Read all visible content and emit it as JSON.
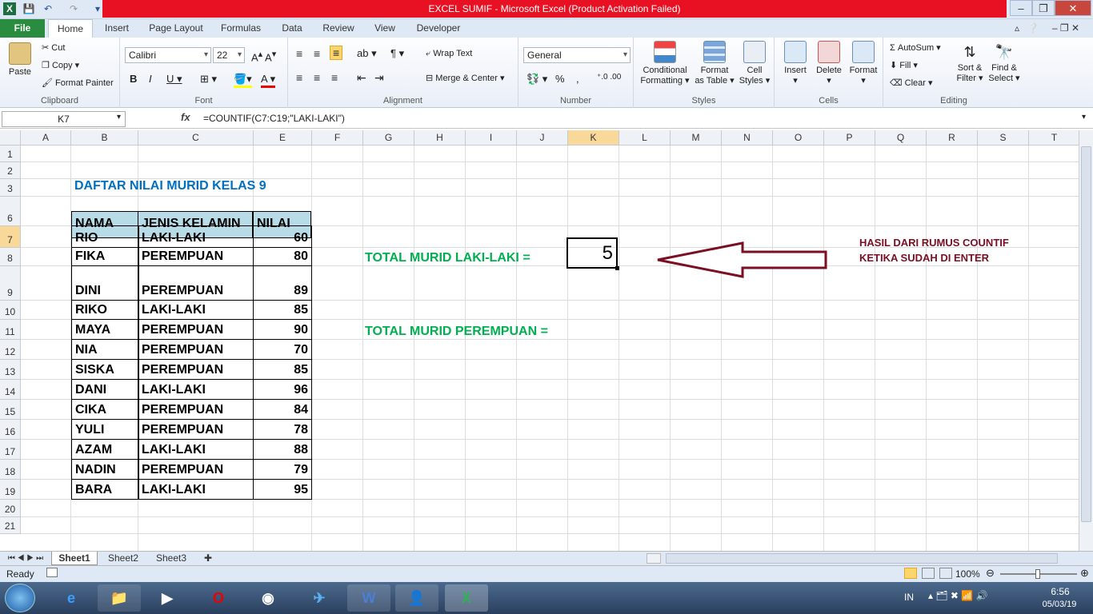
{
  "window": {
    "title": "EXCEL SUMIF -  Microsoft Excel (Product Activation Failed)"
  },
  "tabs": [
    "File",
    "Home",
    "Insert",
    "Page Layout",
    "Formulas",
    "Data",
    "Review",
    "View",
    "Developer"
  ],
  "ribbon": {
    "clipboard": {
      "label": "Clipboard",
      "paste": "Paste",
      "cut": "Cut",
      "copy": "Copy",
      "format_painter": "Format Painter"
    },
    "font": {
      "label": "Font",
      "name": "Calibri",
      "size": "22"
    },
    "alignment": {
      "label": "Alignment",
      "wrap": "Wrap Text",
      "merge": "Merge & Center"
    },
    "number": {
      "label": "Number",
      "format": "General"
    },
    "styles": {
      "label": "Styles",
      "cond1": "Conditional",
      "cond2": "Formatting",
      "fmt1": "Format",
      "fmt2": "as Table",
      "cell1": "Cell",
      "cell2": "Styles"
    },
    "cells": {
      "label": "Cells",
      "insert": "Insert",
      "delete": "Delete",
      "format": "Format"
    },
    "editing": {
      "label": "Editing",
      "autosum": "AutoSum",
      "fill": "Fill",
      "clear": "Clear",
      "sort1": "Sort &",
      "sort2": "Filter",
      "find1": "Find &",
      "find2": "Select"
    }
  },
  "formula_bar": {
    "name_box": "K7",
    "fx": "fx",
    "formula": "=COUNTIF(C7:C19;\"LAKI-LAKI\")"
  },
  "columns": [
    "A",
    "B",
    "C",
    "E",
    "F",
    "G",
    "H",
    "I",
    "J",
    "K",
    "L",
    "M",
    "N",
    "O",
    "P",
    "Q",
    "R",
    "S",
    "T"
  ],
  "rows": [
    "1",
    "2",
    "3",
    "6",
    "7",
    "8",
    "9",
    "10",
    "11",
    "12",
    "13",
    "14",
    "15",
    "16",
    "17",
    "18",
    "19",
    "20",
    "21"
  ],
  "sheet": {
    "title": "DAFTAR NILAI MURID KELAS 9",
    "headers": [
      "NAMA",
      "JENIS KELAMIN",
      "NILAI"
    ],
    "records": [
      [
        "RIO",
        "LAKI-LAKI",
        "60"
      ],
      [
        "FIKA",
        "PEREMPUAN",
        "80"
      ],
      [
        "DINI",
        "PEREMPUAN",
        "89"
      ],
      [
        "RIKO",
        "LAKI-LAKI",
        "85"
      ],
      [
        "MAYA",
        "PEREMPUAN",
        "90"
      ],
      [
        "NIA",
        "PEREMPUAN",
        "70"
      ],
      [
        "SISKA",
        "PEREMPUAN",
        "85"
      ],
      [
        "DANI",
        "LAKI-LAKI",
        "96"
      ],
      [
        "CIKA",
        "PEREMPUAN",
        "84"
      ],
      [
        "YULI",
        "PEREMPUAN",
        "78"
      ],
      [
        "AZAM",
        "LAKI-LAKI",
        "88"
      ],
      [
        "NADIN",
        "PEREMPUAN",
        "79"
      ],
      [
        "BARA",
        "LAKI-LAKI",
        "95"
      ]
    ],
    "total_male_label": "TOTAL MURID LAKI-LAKI =",
    "total_male_value": "5",
    "total_female_label": "TOTAL MURID PEREMPUAN =",
    "note_line1": "HASIL DARI RUMUS COUNTIF",
    "note_line2": "KETIKA SUDAH DI ENTER"
  },
  "sheet_tabs": [
    "Sheet1",
    "Sheet2",
    "Sheet3"
  ],
  "status": {
    "ready": "Ready",
    "zoom": "100%"
  },
  "taskbar": {
    "lang": "IN",
    "time": "6:56",
    "date": "05/03/19"
  },
  "colors": {
    "title_blue": "#0070c0",
    "green_text": "#00b050",
    "note_red": "#7b0e23",
    "header_fill": "#b8dbe8"
  }
}
